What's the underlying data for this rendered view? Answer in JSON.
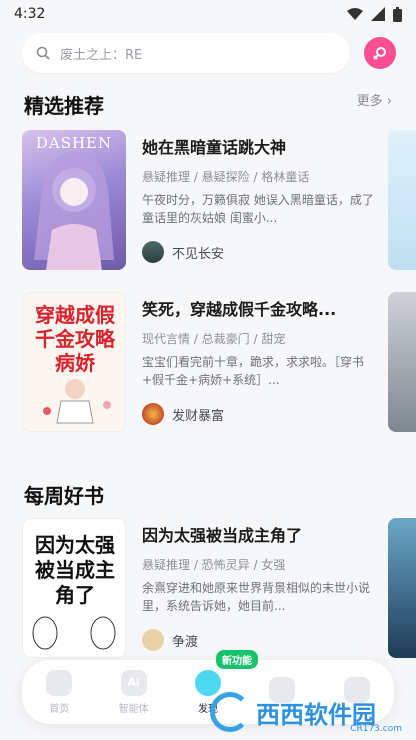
{
  "status": {
    "time": "4:32"
  },
  "search": {
    "placeholder": "废土之上：RE"
  },
  "sections": {
    "featured": {
      "title": "精选推荐",
      "more": "更多"
    },
    "weekly": {
      "title": "每周好书"
    }
  },
  "featured_books": [
    {
      "title": "她在黑暗童话跳大神",
      "tags": "悬疑推理 / 悬疑探险 / 格林童话",
      "desc": "午夜时分，万籁俱寂 她误入黑暗童话，成了童话里的灰姑娘 闺蜜小...",
      "author": "不见长安",
      "cover_text": "DASHEN"
    },
    {
      "title": "笑死，穿越成假千金攻略...",
      "tags": "现代言情 / 总裁豪门 / 甜宠",
      "desc": "宝宝们看完前十章，跪求，求求啦。［穿书+假千金+病娇+系统］...",
      "author": "发财暴富",
      "cover_text": "穿越成假千金攻略病娇"
    }
  ],
  "weekly_books": [
    {
      "title": "因为太强被当成主角了",
      "tags": "悬疑推理 / 恐怖灵异 / 女强",
      "desc": "余熹穿进和她原来世界背景相似的末世小说里，系统告诉她，她目前...",
      "author": "争渡",
      "cover_text": "因为太强被当成主角了"
    }
  ],
  "tabs": [
    {
      "label": "首页"
    },
    {
      "label": "智能体",
      "icon_text": "AI"
    },
    {
      "label": "发现",
      "badge": "新功能"
    },
    {
      "label": ""
    },
    {
      "label": ""
    }
  ],
  "watermark": {
    "text": "西西软件园",
    "sub": "CR173.com"
  },
  "colors": {
    "accent": "#ff4f94",
    "active_tab": "#4bd8f0",
    "badge": "#19c36b"
  }
}
